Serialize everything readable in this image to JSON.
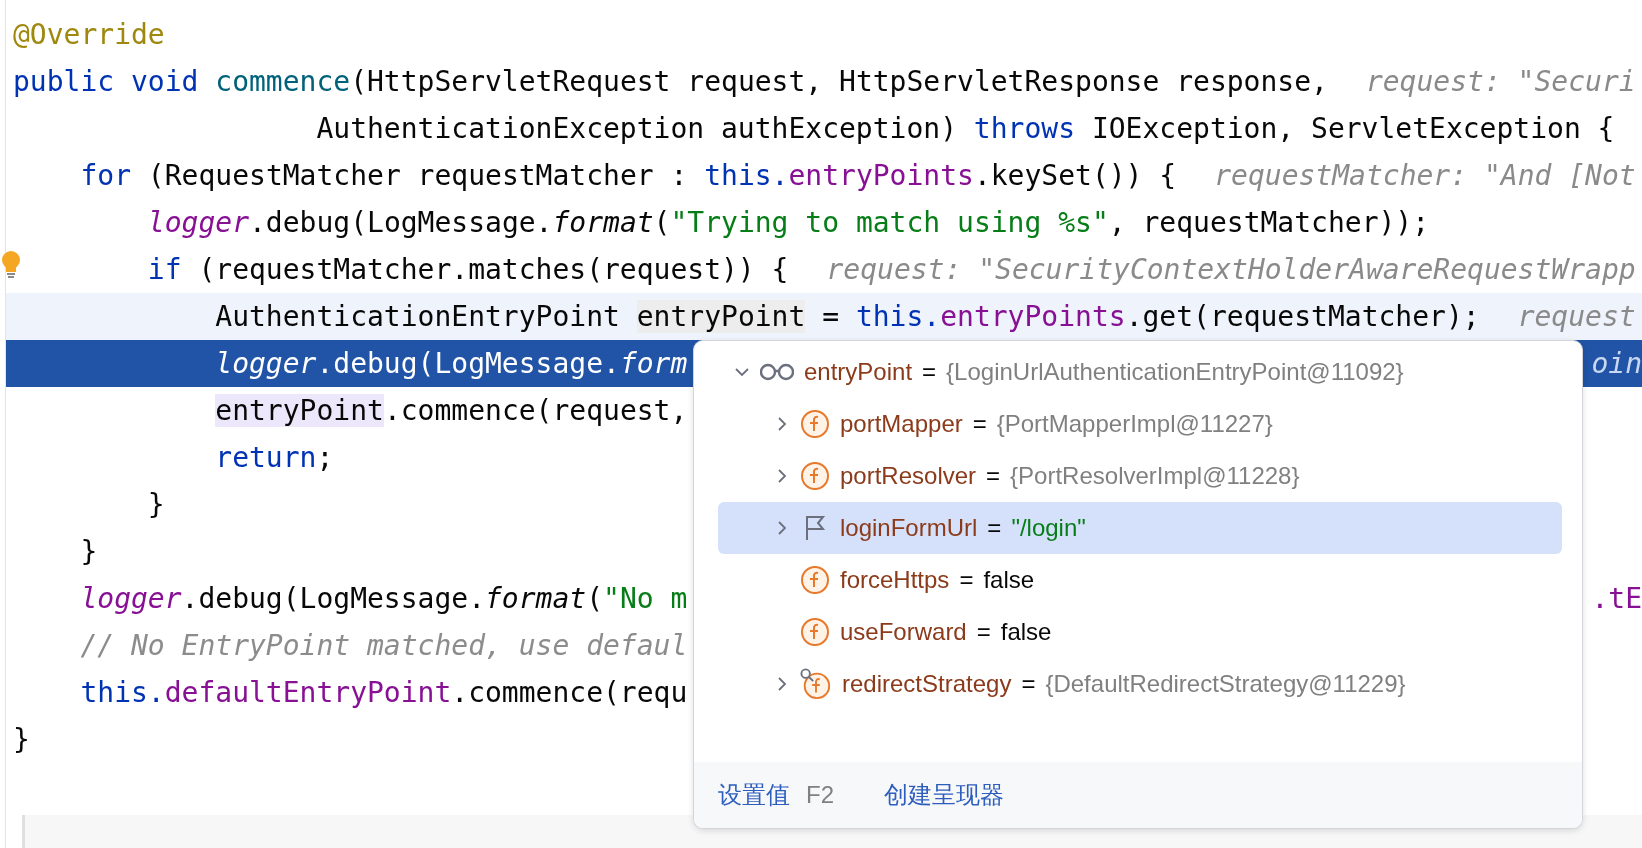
{
  "code_lines": [
    {
      "execution_point": false,
      "caret_line": false,
      "bulb": false,
      "tokens": [
        {
          "kind": "annotation",
          "text": "@Override"
        }
      ]
    },
    {
      "execution_point": false,
      "caret_line": false,
      "bulb": false,
      "tokens": [
        {
          "kind": "keyword",
          "text": "public void"
        },
        {
          "kind": "method",
          "text": " commence"
        },
        {
          "kind": "plain",
          "text": "(HttpServletRequest request, HttpServletResponse response,"
        },
        {
          "kind": "hint",
          "text": "request: \"Securi"
        }
      ]
    },
    {
      "execution_point": false,
      "caret_line": false,
      "bulb": false,
      "tokens": [
        {
          "kind": "plain",
          "text": "                  AuthenticationException authException)"
        },
        {
          "kind": "keyword",
          "text": " throws"
        },
        {
          "kind": "plain",
          "text": " IOException, ServletException {"
        }
      ]
    },
    {
      "execution_point": false,
      "caret_line": false,
      "bulb": false,
      "tokens": [
        {
          "kind": "keyword",
          "text": "    for"
        },
        {
          "kind": "plain",
          "text": " (RequestMatcher requestMatcher :"
        },
        {
          "kind": "keyword",
          "text": " this."
        },
        {
          "kind": "field",
          "text": "entryPoints"
        },
        {
          "kind": "plain",
          "text": ".keySet()) {"
        },
        {
          "kind": "hint",
          "text": "requestMatcher: \"And [Not"
        }
      ]
    },
    {
      "execution_point": false,
      "caret_line": false,
      "bulb": false,
      "tokens": [
        {
          "kind": "static",
          "text": "        logger"
        },
        {
          "kind": "plain",
          "text": ".debug(LogMessage."
        },
        {
          "kind": "italic",
          "text": "format"
        },
        {
          "kind": "plain",
          "text": "("
        },
        {
          "kind": "string",
          "text": "\"Trying to match using %s\""
        },
        {
          "kind": "plain",
          "text": ", requestMatcher));"
        }
      ]
    },
    {
      "execution_point": false,
      "caret_line": false,
      "bulb": true,
      "tokens": [
        {
          "kind": "keyword",
          "text": "        if"
        },
        {
          "kind": "plain",
          "text": " (requestMatcher.matches(request)) {"
        },
        {
          "kind": "hint",
          "text": "request: \"SecurityContextHolderAwareRequestWrapp"
        }
      ]
    },
    {
      "execution_point": false,
      "caret_line": true,
      "bulb": false,
      "tokens": [
        {
          "kind": "plain",
          "text": "            AuthenticationEntryPoint"
        },
        {
          "kind": "read",
          "text": " entryPoint"
        },
        {
          "kind": "plain",
          "text": " ="
        },
        {
          "kind": "keyword",
          "text": " this."
        },
        {
          "kind": "field",
          "text": "entryPoints"
        },
        {
          "kind": "plain",
          "text": ".get(requestMatcher);"
        },
        {
          "kind": "hint",
          "text": "request"
        }
      ]
    },
    {
      "execution_point": true,
      "caret_line": false,
      "bulb": false,
      "tokens": [
        {
          "kind": "static",
          "text": "            logger"
        },
        {
          "kind": "plain",
          "text": ".debug(LogMessage."
        },
        {
          "kind": "italic",
          "text": "form"
        }
      ],
      "tail": [
        {
          "kind": "hint",
          "text": "oin"
        }
      ]
    },
    {
      "execution_point": false,
      "caret_line": false,
      "bulb": false,
      "tokens": [
        {
          "kind": "write",
          "text": "            entryPoint"
        },
        {
          "kind": "plain",
          "text": ".commence(request,"
        }
      ]
    },
    {
      "execution_point": false,
      "caret_line": false,
      "bulb": false,
      "tokens": [
        {
          "kind": "keyword",
          "text": "            return"
        },
        {
          "kind": "plain",
          "text": ";"
        }
      ]
    },
    {
      "execution_point": false,
      "caret_line": false,
      "bulb": false,
      "tokens": [
        {
          "kind": "plain",
          "text": "        }"
        }
      ]
    },
    {
      "execution_point": false,
      "caret_line": false,
      "bulb": false,
      "tokens": [
        {
          "kind": "plain",
          "text": "    }"
        }
      ]
    },
    {
      "execution_point": false,
      "caret_line": false,
      "bulb": false,
      "tokens": [
        {
          "kind": "static",
          "text": "    logger"
        },
        {
          "kind": "plain",
          "text": ".debug(LogMessage."
        },
        {
          "kind": "italic",
          "text": "format"
        },
        {
          "kind": "plain",
          "text": "("
        },
        {
          "kind": "string",
          "text": "\"No m"
        }
      ],
      "tail": [
        {
          "kind": "field",
          "text": ".tE"
        }
      ]
    },
    {
      "execution_point": false,
      "caret_line": false,
      "bulb": false,
      "tokens": [
        {
          "kind": "comment",
          "text": "    // No EntryPoint matched, use defaul"
        }
      ]
    },
    {
      "execution_point": false,
      "caret_line": false,
      "bulb": false,
      "tokens": [
        {
          "kind": "keyword",
          "text": "    this."
        },
        {
          "kind": "field",
          "text": "defaultEntryPoint"
        },
        {
          "kind": "plain",
          "text": ".commence(requ"
        }
      ]
    },
    {
      "execution_point": false,
      "caret_line": false,
      "bulb": false,
      "tokens": [
        {
          "kind": "plain",
          "text": "}"
        }
      ]
    }
  ],
  "popup": {
    "tree": [
      {
        "kind": "watch",
        "name": "entryPoint",
        "separator": "=",
        "value": "{LoginUrlAuthenticationEntryPoint@11092}",
        "color": "#808080",
        "expandable": true,
        "expanded": true,
        "selected": false,
        "children": [
          {
            "kind": "field",
            "name": "portMapper",
            "separator": "=",
            "value": "{PortMapperImpl@11227}",
            "color": "#808080",
            "expandable": true,
            "expanded": false,
            "selected": false
          },
          {
            "kind": "field",
            "name": "portResolver",
            "separator": "=",
            "value": "{PortResolverImpl@11228}",
            "color": "#808080",
            "expandable": true,
            "expanded": false,
            "selected": false
          },
          {
            "kind": "flag",
            "name": "loginFormUrl",
            "separator": "=",
            "value": "\"/login\"",
            "color": "#067d17",
            "expandable": true,
            "expanded": false,
            "selected": true
          },
          {
            "kind": "field",
            "name": "forceHttps",
            "separator": "=",
            "value": "false",
            "color": "#080808",
            "expandable": false,
            "selected": false
          },
          {
            "kind": "field",
            "name": "useForward",
            "separator": "=",
            "value": "false",
            "color": "#080808",
            "expandable": false,
            "selected": false
          },
          {
            "kind": "field_marked",
            "name": "redirectStrategy",
            "separator": "=",
            "value": "{DefaultRedirectStrategy@11229}",
            "color": "#808080",
            "expandable": true,
            "expanded": false,
            "selected": false
          }
        ]
      }
    ],
    "footer": [
      {
        "kind": "link",
        "text": "设置值"
      },
      {
        "kind": "shortcut",
        "text": "F2"
      },
      {
        "kind": "link",
        "text": "创建呈现器"
      }
    ]
  }
}
